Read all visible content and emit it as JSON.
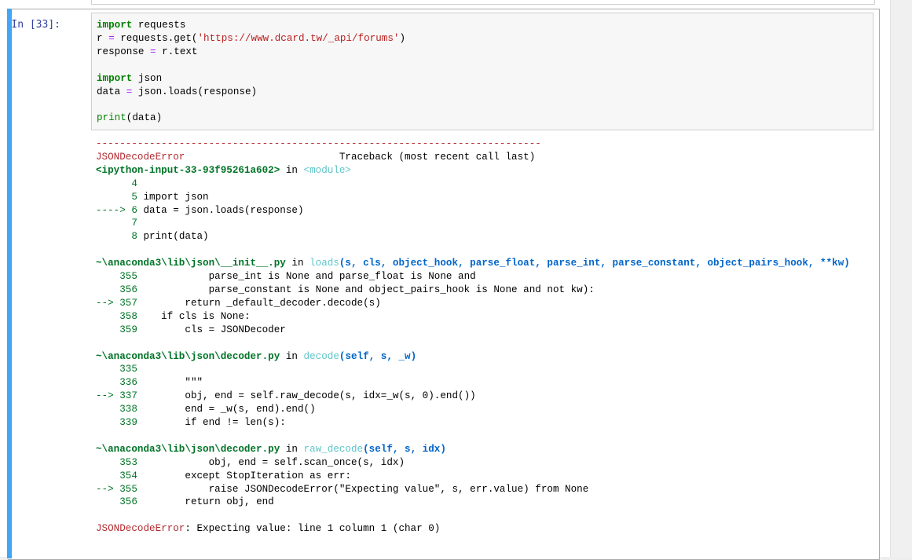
{
  "cell": {
    "prompt": "In [33]:",
    "code": {
      "l1_import": "import",
      "l1_mod": " requests",
      "l2_var": "r ",
      "l2_eq": "=",
      "l2_call": " requests.get(",
      "l2_url": "'https://www.dcard.tw/_api/forums'",
      "l2_close": ")",
      "l3_var": "response ",
      "l3_eq": "=",
      "l3_rest": " r.text",
      "l5_import": "import",
      "l5_mod": " json",
      "l6_var": "data ",
      "l6_eq": "=",
      "l6_rest": " json.loads(response)",
      "l8_print": "print",
      "l8_rest": "(data)"
    }
  },
  "traceback": {
    "separator": "---------------------------------------------------------------------------",
    "error_name": "JSONDecodeError",
    "header_right": "                          Traceback (most recent call last)",
    "frame1": {
      "location": "<ipython-input-33-93f95261a602>",
      "in": " in ",
      "func": "<module>",
      "lines": [
        {
          "arrow": "      ",
          "num": "4",
          "code": ""
        },
        {
          "arrow": "      ",
          "num": "5",
          "code": " import json"
        },
        {
          "arrow": "----> ",
          "num": "6",
          "code": " data = json.loads(response)"
        },
        {
          "arrow": "      ",
          "num": "7",
          "code": ""
        },
        {
          "arrow": "      ",
          "num": "8",
          "code": " print(data)"
        }
      ]
    },
    "frame2": {
      "location": "~\\anaconda3\\lib\\json\\__init__.py",
      "in": " in ",
      "func": "loads",
      "args": "(s, cls, object_hook, parse_float, parse_int, parse_constant, object_pairs_hook, **kw)",
      "lines": [
        {
          "arrow": "    ",
          "num": "355",
          "code": "            parse_int is None and parse_float is None and"
        },
        {
          "arrow": "    ",
          "num": "356",
          "code": "            parse_constant is None and object_pairs_hook is None and not kw):"
        },
        {
          "arrow": "--> ",
          "num": "357",
          "code": "        return _default_decoder.decode(s)"
        },
        {
          "arrow": "    ",
          "num": "358",
          "code": "    if cls is None:"
        },
        {
          "arrow": "    ",
          "num": "359",
          "code": "        cls = JSONDecoder"
        }
      ]
    },
    "frame3": {
      "location": "~\\anaconda3\\lib\\json\\decoder.py",
      "in": " in ",
      "func": "decode",
      "args": "(self, s, _w)",
      "lines": [
        {
          "arrow": "    ",
          "num": "335",
          "code": ""
        },
        {
          "arrow": "    ",
          "num": "336",
          "code": "        \"\"\""
        },
        {
          "arrow": "--> ",
          "num": "337",
          "code": "        obj, end = self.raw_decode(s, idx=_w(s, 0).end())"
        },
        {
          "arrow": "    ",
          "num": "338",
          "code": "        end = _w(s, end).end()"
        },
        {
          "arrow": "    ",
          "num": "339",
          "code": "        if end != len(s):"
        }
      ]
    },
    "frame4": {
      "location": "~\\anaconda3\\lib\\json\\decoder.py",
      "in": " in ",
      "func": "raw_decode",
      "args": "(self, s, idx)",
      "lines": [
        {
          "arrow": "    ",
          "num": "353",
          "code": "            obj, end = self.scan_once(s, idx)"
        },
        {
          "arrow": "    ",
          "num": "354",
          "code": "        except StopIteration as err:"
        },
        {
          "arrow": "--> ",
          "num": "355",
          "code": "            raise JSONDecodeError(\"Expecting value\", s, err.value) from None"
        },
        {
          "arrow": "    ",
          "num": "356",
          "code": "        return obj, end"
        }
      ]
    },
    "final_error": "JSONDecodeError",
    "final_message": ": Expecting value: line 1 column 1 (char 0)"
  }
}
